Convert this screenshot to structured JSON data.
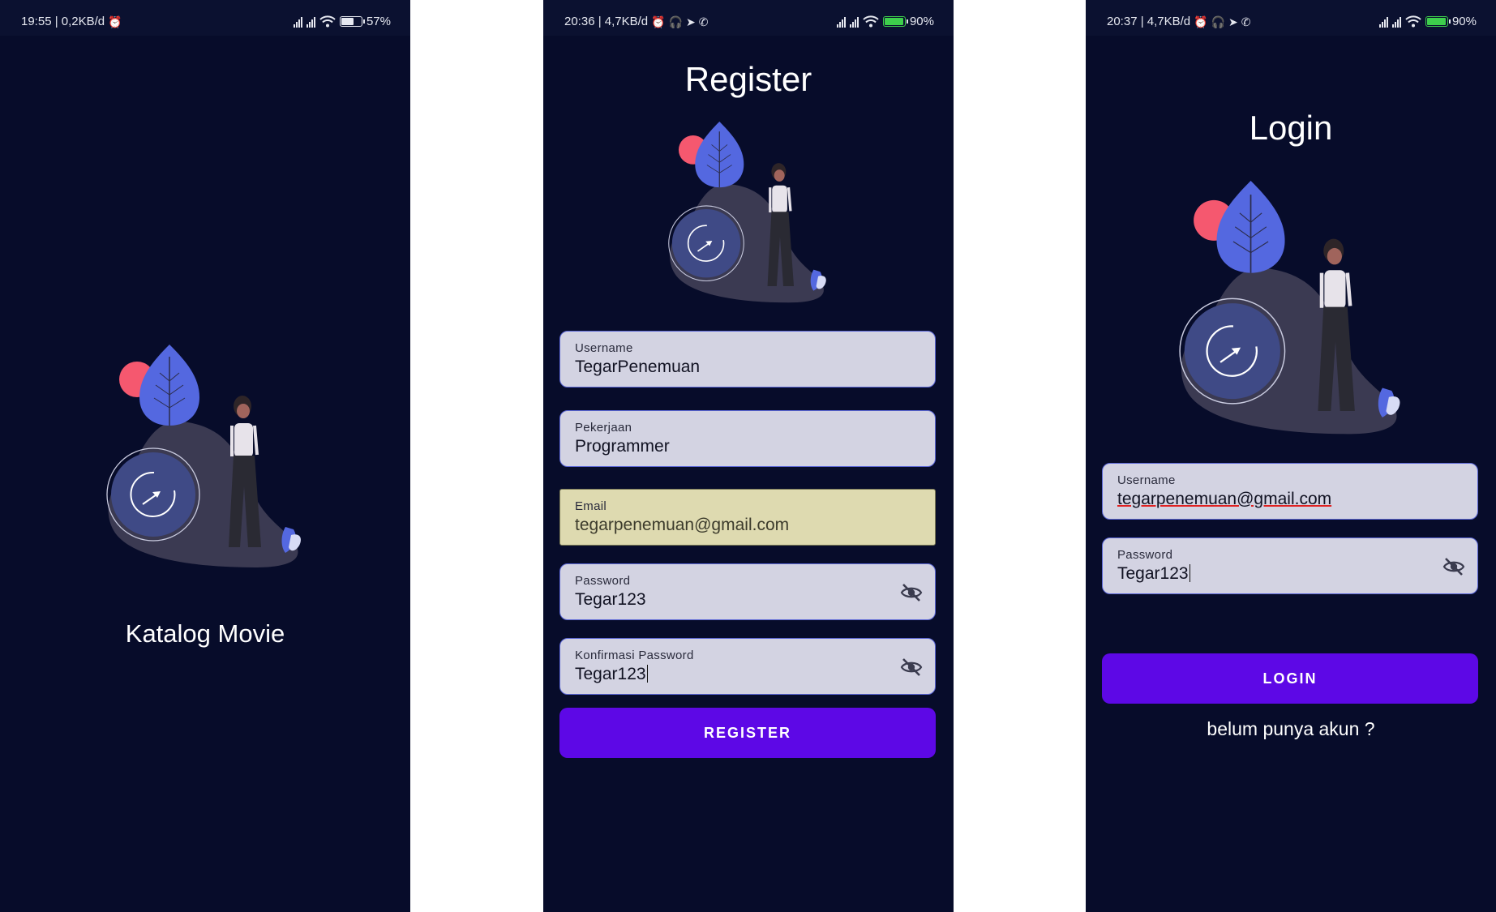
{
  "splash": {
    "status": {
      "left": "19:55 | 0,2KB/d",
      "battery": "57%",
      "battery_level": 0.57
    },
    "app_name": "Katalog Movie"
  },
  "register": {
    "status": {
      "left": "20:36 | 4,7KB/d",
      "battery": "90%",
      "battery_level": 0.9
    },
    "title": "Register",
    "fields": [
      {
        "label": "Username",
        "value": "TegarPenemuan"
      },
      {
        "label": "Pekerjaan",
        "value": "Programmer"
      },
      {
        "label": "Email",
        "value": "tegarpenemuan@gmail.com"
      },
      {
        "label": "Password",
        "value": "Tegar123"
      },
      {
        "label": "Konfirmasi Password",
        "value": "Tegar123"
      }
    ],
    "button": "REGISTER"
  },
  "login": {
    "status": {
      "left": "20:37 | 4,7KB/d",
      "battery": "90%",
      "battery_level": 0.9
    },
    "title": "Login",
    "fields": [
      {
        "label": "Username",
        "value": "tegarpenemuan@gmail.com"
      },
      {
        "label": "Password",
        "value": "Tegar123"
      }
    ],
    "button": "LOGIN",
    "signup_link": "belum punya akun ?"
  },
  "icons": {
    "status_left": [
      "alarm-icon",
      "headphones-icon",
      "telegram-icon",
      "whatsapp-icon"
    ],
    "status_right": [
      "signal-icon",
      "wifi-icon",
      "battery-icon"
    ],
    "field_trailing": "visibility-off-icon"
  },
  "colors": {
    "background": "#070c2a",
    "field_bg": "#d3d3e2",
    "field_border": "#5a66d6",
    "autofill_bg": "#dedab0",
    "button": "#5d08e6",
    "leaf": "#5468e0",
    "circle": "#f5586f"
  }
}
